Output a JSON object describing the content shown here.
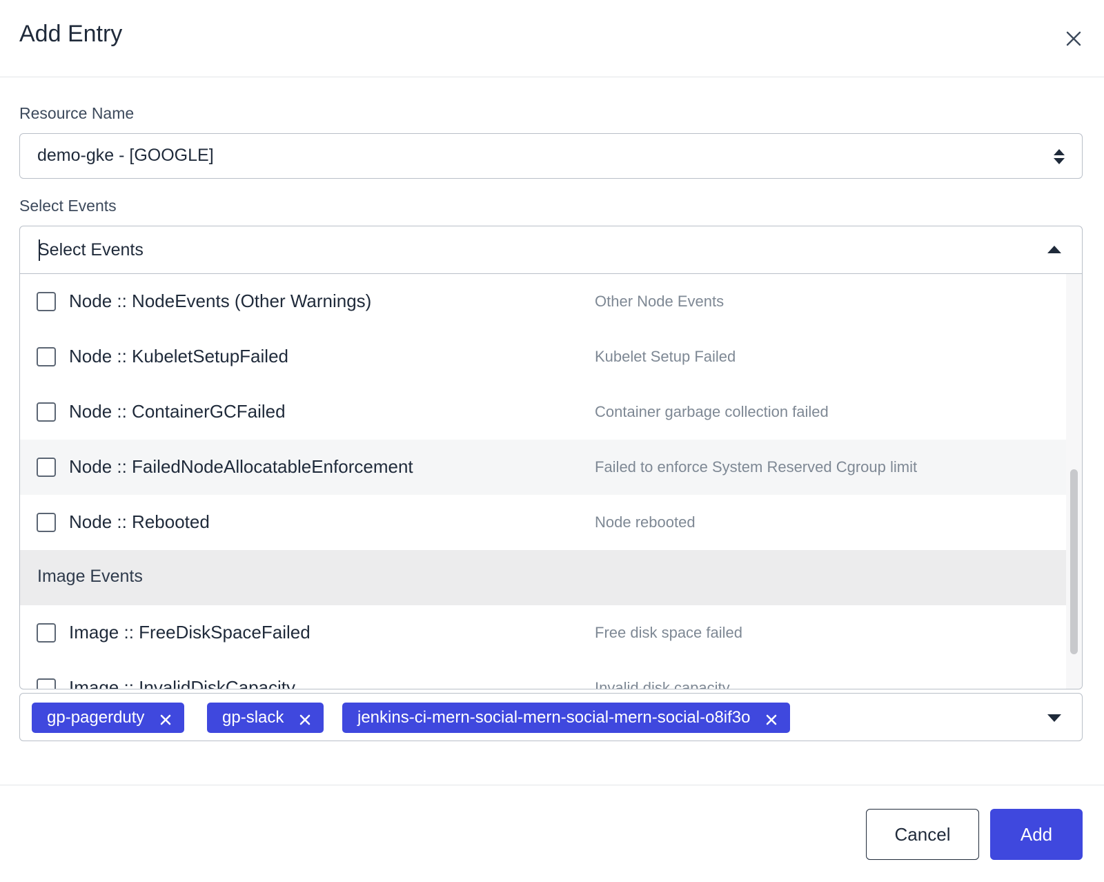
{
  "dialog": {
    "title": "Add Entry"
  },
  "resource": {
    "label": "Resource Name",
    "value": "demo-gke - [GOOGLE]"
  },
  "events": {
    "label": "Select Events",
    "placeholder": "Select Events",
    "options": [
      {
        "label": "Node :: NodeEvents (Other Warnings)",
        "description": "Other Node Events",
        "checked": false
      },
      {
        "label": "Node :: KubeletSetupFailed",
        "description": "Kubelet Setup Failed",
        "checked": false
      },
      {
        "label": "Node :: ContainerGCFailed",
        "description": "Container garbage collection failed",
        "checked": false
      },
      {
        "label": "Node :: FailedNodeAllocatableEnforcement",
        "description": "Failed to enforce System Reserved Cgroup limit",
        "checked": false
      },
      {
        "label": "Node :: Rebooted",
        "description": "Node rebooted",
        "checked": false
      }
    ],
    "group": "Image Events",
    "group_options": [
      {
        "label": "Image :: FreeDiskSpaceFailed",
        "description": "Free disk space failed",
        "checked": false
      },
      {
        "label": "Image :: InvalidDiskCapacity",
        "description": "Invalid disk capacity",
        "checked": false
      }
    ]
  },
  "channels": {
    "tags": [
      "gp-pagerduty",
      "gp-slack",
      "jenkins-ci-mern-social-mern-social-mern-social-o8if3o"
    ]
  },
  "footer": {
    "cancel_label": "Cancel",
    "add_label": "Add"
  },
  "colors": {
    "primary": "#3f48de",
    "text": "#1f2a3a",
    "muted": "#7e8894",
    "border": "#b9bfc8"
  }
}
